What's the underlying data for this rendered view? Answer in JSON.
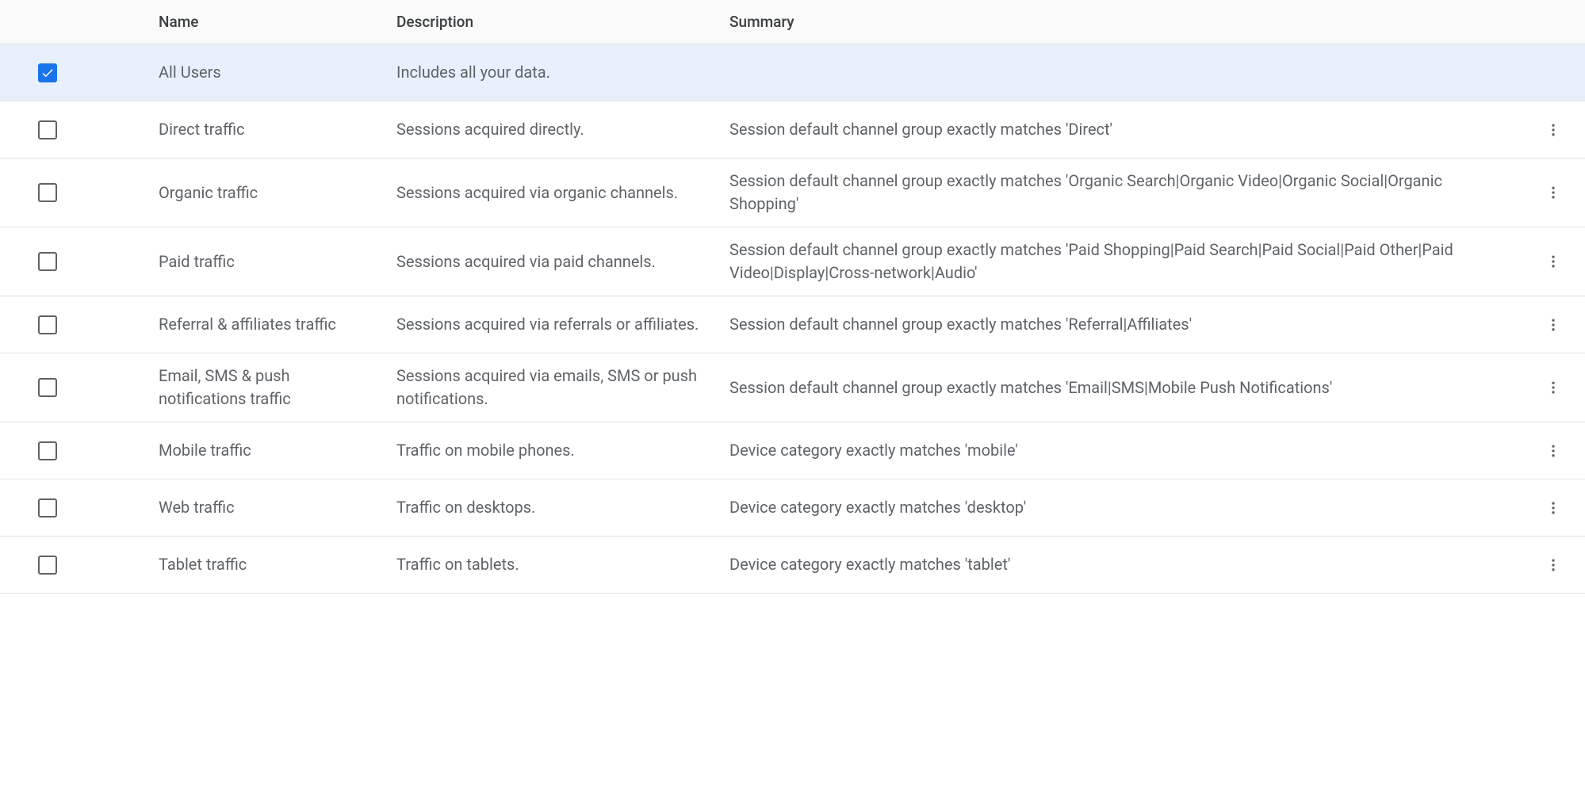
{
  "columns": {
    "name": "Name",
    "description": "Description",
    "summary": "Summary"
  },
  "rows": [
    {
      "checked": true,
      "name": "All Users",
      "description": "Includes all your data.",
      "summary": "",
      "has_actions": false
    },
    {
      "checked": false,
      "name": "Direct traffic",
      "description": "Sessions acquired directly.",
      "summary": "Session default channel group exactly matches 'Direct'",
      "has_actions": true
    },
    {
      "checked": false,
      "name": "Organic traffic",
      "description": "Sessions acquired via organic channels.",
      "summary": "Session default channel group exactly matches 'Organic Search|Organic Video|Organic Social|Organic Shopping'",
      "has_actions": true
    },
    {
      "checked": false,
      "name": "Paid traffic",
      "description": "Sessions acquired via paid channels.",
      "summary": "Session default channel group exactly matches 'Paid Shopping|Paid Search|Paid Social|Paid Other|Paid Video|Display|Cross-network|Audio'",
      "has_actions": true
    },
    {
      "checked": false,
      "name": "Referral & affiliates traffic",
      "description": "Sessions acquired via referrals or affiliates.",
      "summary": "Session default channel group exactly matches 'Referral|Affiliates'",
      "has_actions": true
    },
    {
      "checked": false,
      "name": "Email, SMS & push notifications traffic",
      "description": "Sessions acquired via emails, SMS or push notifications.",
      "summary": "Session default channel group exactly matches 'Email|SMS|Mobile Push Notifications'",
      "has_actions": true
    },
    {
      "checked": false,
      "name": "Mobile traffic",
      "description": "Traffic on mobile phones.",
      "summary": "Device category exactly matches 'mobile'",
      "has_actions": true
    },
    {
      "checked": false,
      "name": "Web traffic",
      "description": "Traffic on desktops.",
      "summary": "Device category exactly matches 'desktop'",
      "has_actions": true
    },
    {
      "checked": false,
      "name": "Tablet traffic",
      "description": "Traffic on tablets.",
      "summary": "Device category exactly matches 'tablet'",
      "has_actions": true
    }
  ]
}
